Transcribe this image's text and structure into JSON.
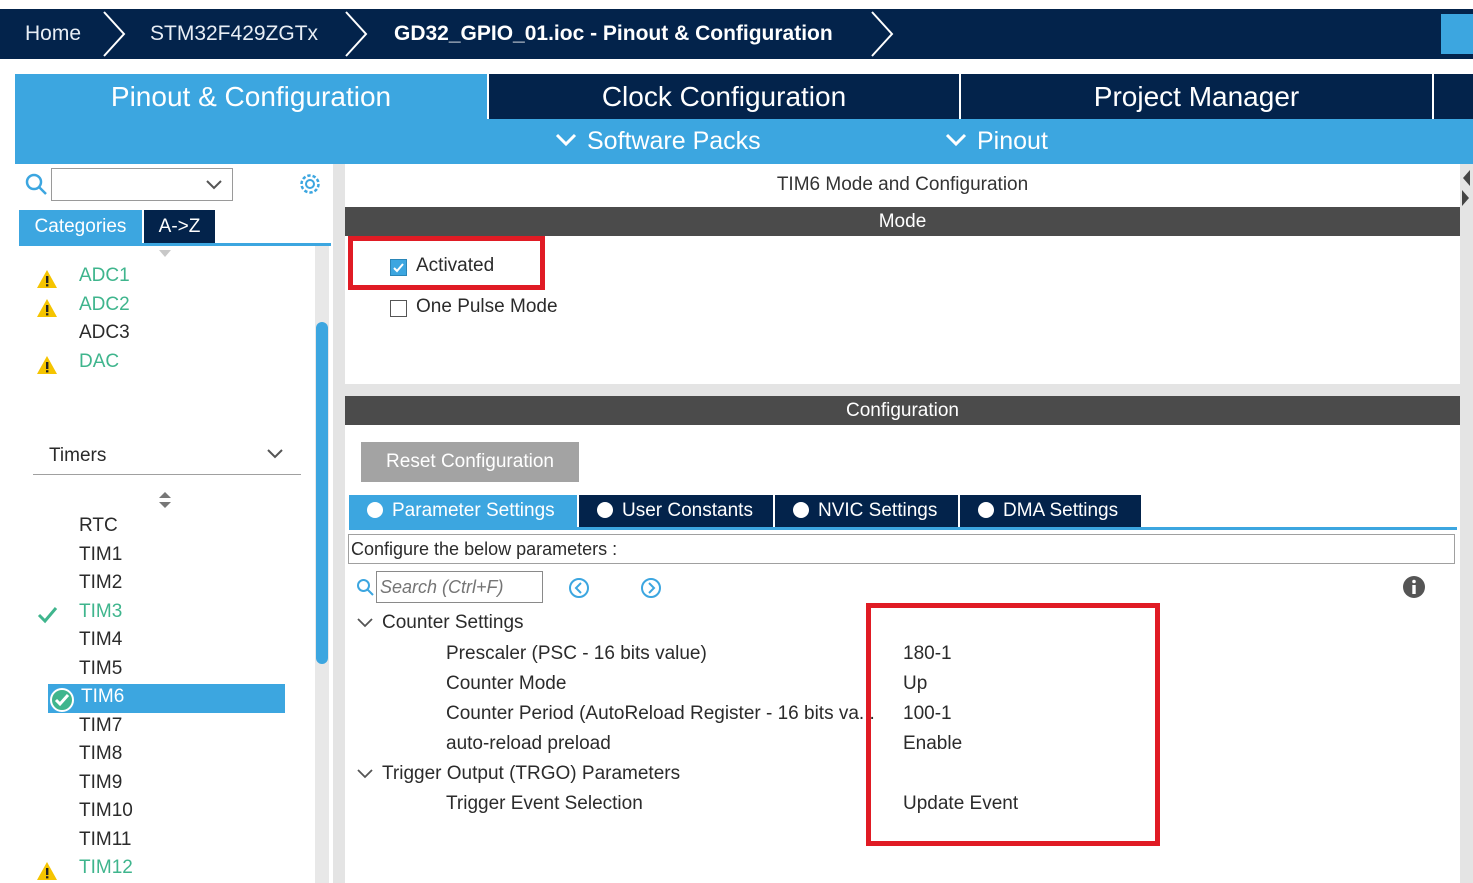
{
  "breadcrumb": {
    "home": "Home",
    "device": "STM32F429ZGTx",
    "file": "GD32_GPIO_01.ioc - Pinout & Configuration"
  },
  "main_tabs": {
    "pinout": "Pinout & Configuration",
    "clock": "Clock Configuration",
    "project": "Project Manager"
  },
  "sub_menu": {
    "software_packs": "Software Packs",
    "pinout": "Pinout"
  },
  "left": {
    "search_value": "",
    "tab_categories": "Categories",
    "tab_az": "A->Z",
    "analog_items": [
      {
        "label": "ADC1",
        "status": "warning"
      },
      {
        "label": "ADC2",
        "status": "warning"
      },
      {
        "label": "ADC3",
        "status": "none"
      },
      {
        "label": "DAC",
        "status": "warning"
      }
    ],
    "timers_header": "Timers",
    "timer_items": [
      {
        "label": "RTC",
        "status": "none"
      },
      {
        "label": "TIM1",
        "status": "none"
      },
      {
        "label": "TIM2",
        "status": "none"
      },
      {
        "label": "TIM3",
        "status": "ok"
      },
      {
        "label": "TIM4",
        "status": "none"
      },
      {
        "label": "TIM5",
        "status": "none"
      },
      {
        "label": "TIM6",
        "status": "selected"
      },
      {
        "label": "TIM7",
        "status": "none"
      },
      {
        "label": "TIM8",
        "status": "none"
      },
      {
        "label": "TIM9",
        "status": "none"
      },
      {
        "label": "TIM10",
        "status": "none"
      },
      {
        "label": "TIM11",
        "status": "none"
      },
      {
        "label": "TIM12",
        "status": "warning"
      }
    ]
  },
  "right": {
    "title": "TIM6 Mode and Configuration",
    "mode_header": "Mode",
    "activated_label": "Activated",
    "activated_checked": true,
    "one_pulse_label": "One Pulse Mode",
    "one_pulse_checked": false,
    "config_header": "Configuration",
    "reset_button": "Reset Configuration",
    "tabs": {
      "param": "Parameter Settings",
      "user": "User Constants",
      "nvic": "NVIC Settings",
      "dma": "DMA Settings"
    },
    "configure_text": "Configure the below parameters :",
    "search_placeholder": "Search (Ctrl+F)",
    "groups": {
      "counter": "Counter Settings",
      "trigger": "Trigger Output (TRGO) Parameters"
    },
    "params": {
      "prescaler_name": "Prescaler (PSC - 16 bits value)",
      "prescaler_value": "180-1",
      "mode_name": "Counter Mode",
      "mode_value": "Up",
      "period_name": "Counter Period (AutoReload Register - 16 bits va...",
      "period_value": "100-1",
      "preload_name": "auto-reload preload",
      "preload_value": "Enable",
      "trigger_name": "Trigger Event Selection",
      "trigger_value": "Update Event"
    }
  },
  "colors": {
    "dark_navy": "#03234b",
    "accent_blue": "#3ca6e0",
    "ok_green": "#3fb58d",
    "warning_yellow": "#f5c400",
    "highlight_red": "#e01b24"
  }
}
